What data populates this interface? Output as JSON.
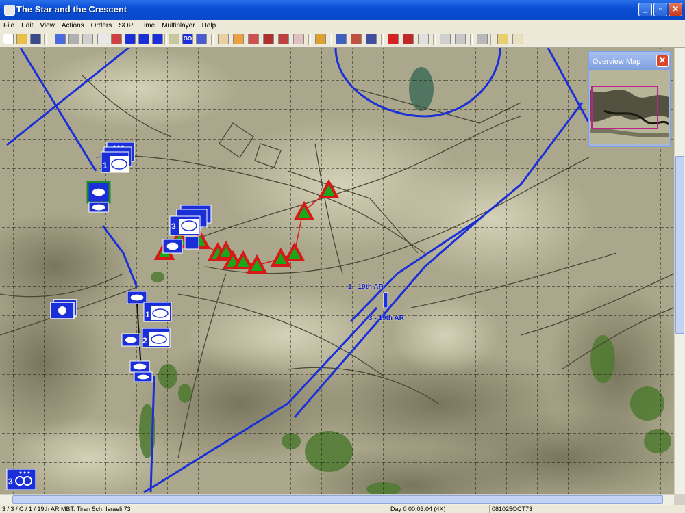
{
  "window": {
    "title": "The Star and the Crescent",
    "minimize": "_",
    "maximize": "▫",
    "close": "✕"
  },
  "menu": [
    "File",
    "Edit",
    "View",
    "Actions",
    "Orders",
    "SOP",
    "Time",
    "Multiplayer",
    "Help"
  ],
  "toolbar": {
    "go_label": "GO"
  },
  "overview_map": {
    "title": "Overview Map",
    "close": "✕"
  },
  "map": {
    "unit_labels": {
      "label_1": "1 - 19th AR",
      "label_2": "3 - 19th AR"
    },
    "unit_numbers": {
      "north_stack": "1",
      "center_stack": "3",
      "south_stack_a": "1",
      "south_stack_b": "2",
      "corner_unit": "3"
    }
  },
  "status": {
    "unit_info": "3 / 3 / C / 1 / 19th AR  MBT: Tiran 5ch: Israeli 73",
    "game_time": "Day 0  00:03:04 (4X)",
    "date_code": "081025OCT73"
  },
  "colors": {
    "friendly_blue": "#1a2fd8",
    "enemy_red": "#d81818",
    "enemy_green": "#18a818",
    "selected_green": "#1c8c2c",
    "accent_magenta": "#c0208c"
  }
}
